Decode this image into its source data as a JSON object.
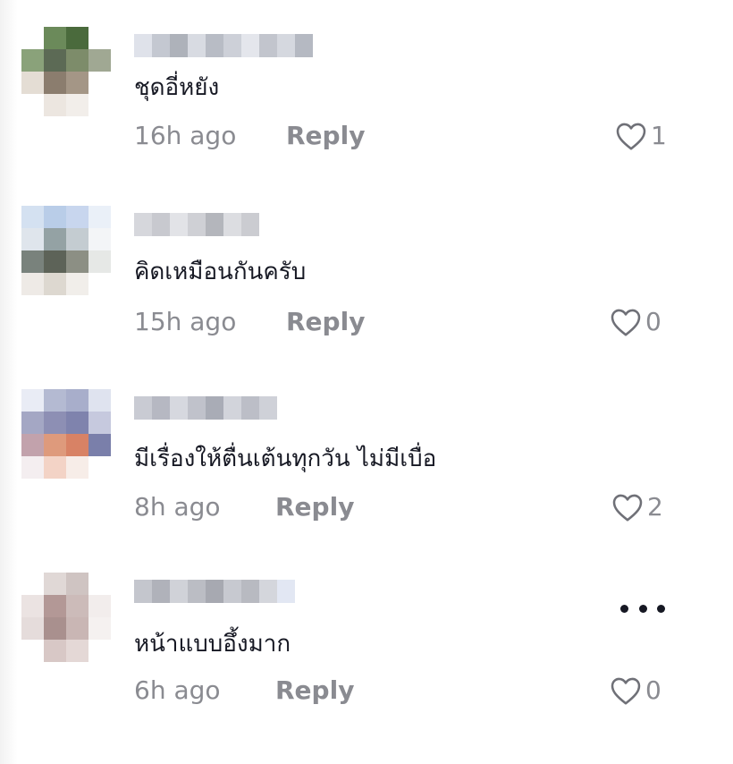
{
  "comments": [
    {
      "text": "ชุดอี่หยัง",
      "time": "16h ago",
      "reply_label": "Reply",
      "likes": "1",
      "avatar_colors": [
        "#ffffff",
        "#6b8a5a",
        "#4a6a3c",
        "#ffffff",
        "#8aa27a",
        "#5c6a55",
        "#7d8c6a",
        "#a0a893",
        "#e4ddd4",
        "#8b7d6e",
        "#a49686",
        "#ffffff",
        "#ffffff",
        "#ece6e0",
        "#f2eeea",
        "#ffffff"
      ],
      "username_colors": [
        "#dfe2ea",
        "#c4c8d1",
        "#aeb2ba",
        "#d8dbe2",
        "#b8bcc5",
        "#cdd0d8",
        "#e4e6ec",
        "#c2c5cd",
        "#d5d8df",
        "#b5b9c2"
      ]
    },
    {
      "text": "คิดเหมือนกันครับ",
      "time": "15h ago",
      "reply_label": "Reply",
      "likes": "0",
      "avatar_colors": [
        "#d4e1f1",
        "#b9cde8",
        "#c8d6ee",
        "#eaf0f8",
        "#dfe5ec",
        "#94a2a4",
        "#c4ccd1",
        "#f3f5f7",
        "#79827c",
        "#5d6358",
        "#8c8f84",
        "#e6e8e6",
        "#eeeae6",
        "#ddd8d0",
        "#f1eeea",
        "#ffffff"
      ],
      "username_colors": [
        "#d6d7dc",
        "#c8c9cf",
        "#e2e3e7",
        "#cfd0d5",
        "#b4b6bc",
        "#dcdde1",
        "#cbccd1"
      ]
    },
    {
      "text": "มีเรื่องให้ตื่นเต้นทุกวัน ไม่มีเบื่อ",
      "time": "8h ago",
      "reply_label": "Reply",
      "likes": "2",
      "avatar_colors": [
        "#e9ecf5",
        "#b4bad2",
        "#a8aecb",
        "#dfe3ef",
        "#a4a7c4",
        "#8d8fb4",
        "#7f83ad",
        "#c6c9de",
        "#c2a2ac",
        "#de9a7c",
        "#d88265",
        "#7a7faa",
        "#f4eef0",
        "#f3d3c6",
        "#f7ede8",
        "#ffffff"
      ],
      "username_colors": [
        "#c9cbd3",
        "#b6b8c2",
        "#d6d8df",
        "#c0c2cb",
        "#a9acb6",
        "#d2d4db",
        "#bcbec7",
        "#cfd1d8"
      ]
    },
    {
      "text": "หน้าแบบอึ้งมาก",
      "time": "6h ago",
      "reply_label": "Reply",
      "likes": "0",
      "avatar_colors": [
        "#ffffff",
        "#e0d8d6",
        "#cfc4c2",
        "#ffffff",
        "#ebe3e2",
        "#b39896",
        "#ccbbb9",
        "#f2edec",
        "#e5dcdb",
        "#a9908e",
        "#c9b6b4",
        "#f5f1f0",
        "#ffffff",
        "#d8c8c6",
        "#e4d8d6",
        "#ffffff"
      ],
      "username_colors": [
        "#c4c6cd",
        "#b0b2ba",
        "#d0d2d8",
        "#bbbdc4",
        "#a7a9b1",
        "#c7c9d0",
        "#b8bac1",
        "#d4d6dc",
        "#e2e7f3"
      ]
    }
  ],
  "menu": {
    "more_icon": "more-horizontal-icon"
  },
  "colors": {
    "text": "#161823",
    "meta": "#8a8b91",
    "background": "#ffffff"
  }
}
